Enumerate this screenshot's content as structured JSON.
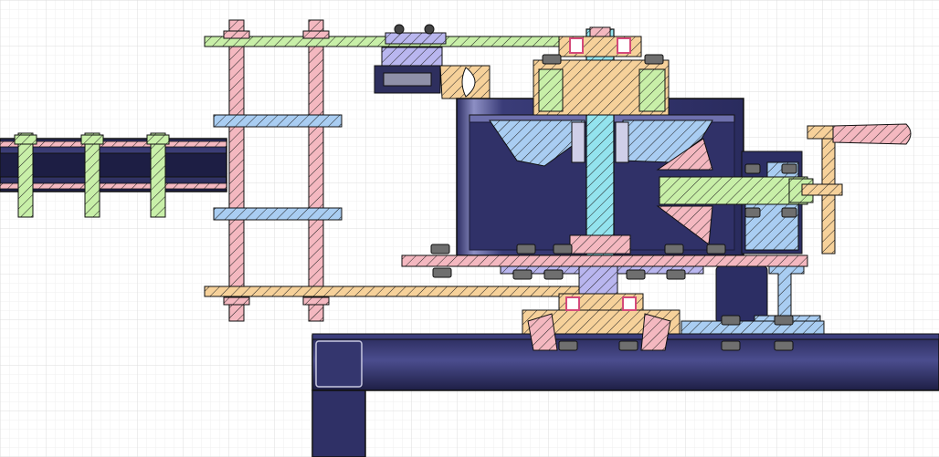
{
  "canvas": {
    "background": "#ffffff",
    "grid_major_color": "#dcdcdc",
    "grid_minor_color": "#efefef",
    "grid_visible": true
  },
  "palette": {
    "steel": "#2e2f63",
    "steel_dark": "#1c1d40",
    "steel_light": "#5a5c9c",
    "outline": "#111111",
    "hatch_pink": "#f4b8c0",
    "hatch_blue": "#a9cdf2",
    "hatch_green": "#c8efa8",
    "hatch_orange": "#f6d19a",
    "hatch_violet": "#b9b6ef",
    "hatch_cyan": "#93e3ee",
    "bearing": "#d44a7a",
    "bolt": "#6f6f6f"
  },
  "view": {
    "type": "mechanical-cross-section",
    "labels": []
  }
}
